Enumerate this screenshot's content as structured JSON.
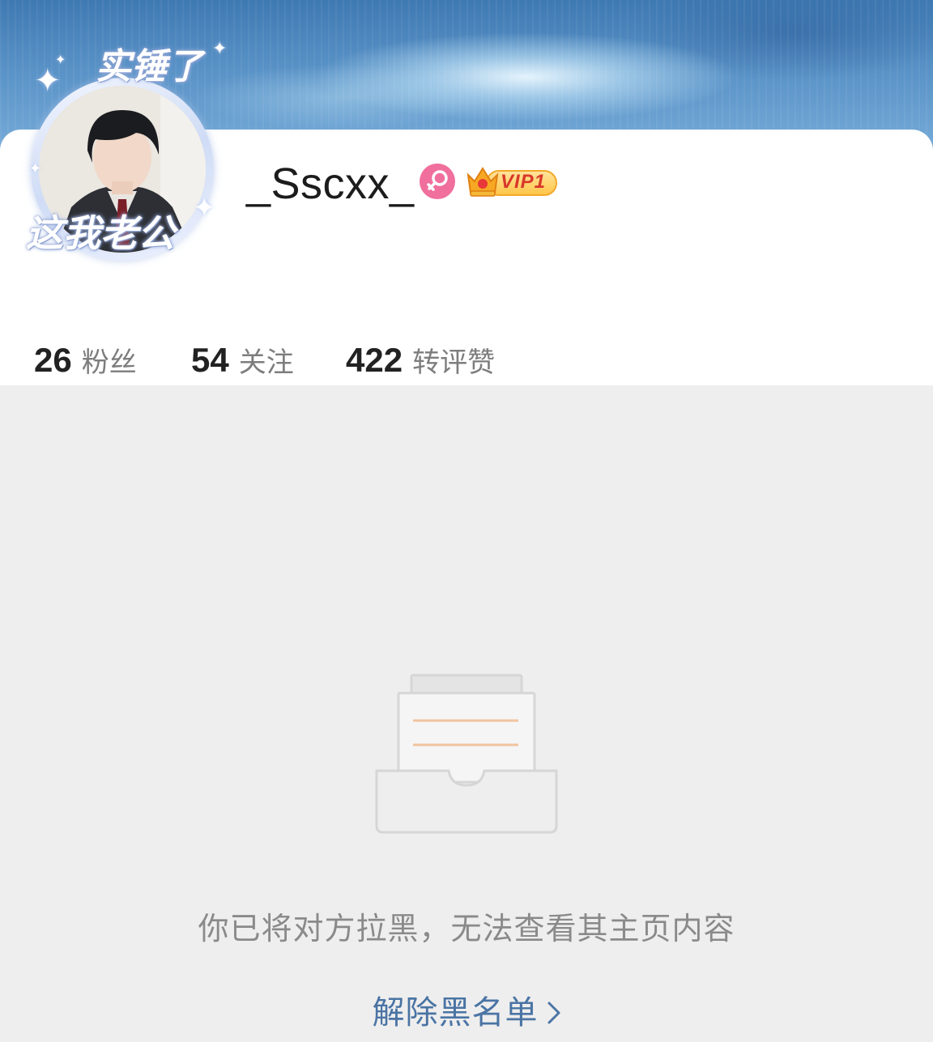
{
  "profile": {
    "username": "_Sscxx_",
    "gender_icon": "female-symbol-icon",
    "vip_label": "VIP1",
    "avatar_frame_top_text": "实锤了",
    "avatar_frame_bottom_text": "这我老公"
  },
  "stats": [
    {
      "value": "26",
      "label": "粉丝"
    },
    {
      "value": "54",
      "label": "关注"
    },
    {
      "value": "422",
      "label": "转评赞"
    }
  ],
  "blocked": {
    "message": "你已将对方拉黑，无法查看其主页内容",
    "unblock_label": "解除黑名单"
  },
  "colors": {
    "link": "#4a74a4",
    "gender_badge": "#f06f9c",
    "vip_gold": "#ffc74a",
    "page_background": "#eeeeee"
  }
}
